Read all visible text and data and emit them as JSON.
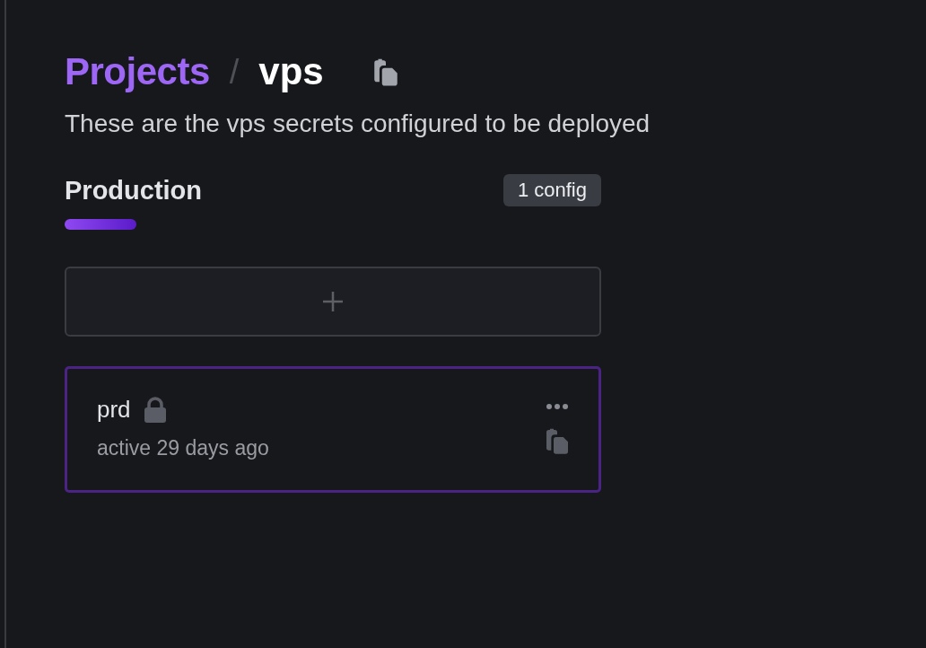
{
  "breadcrumb": {
    "parent": "Projects",
    "separator": "/",
    "current": "vps"
  },
  "description": "These are the vps secrets configured to be deployed",
  "environment": {
    "name": "Production",
    "badge": "1 config",
    "configs": [
      {
        "name": "prd",
        "locked": true,
        "selected": true,
        "status": "active 29 days ago"
      }
    ]
  }
}
